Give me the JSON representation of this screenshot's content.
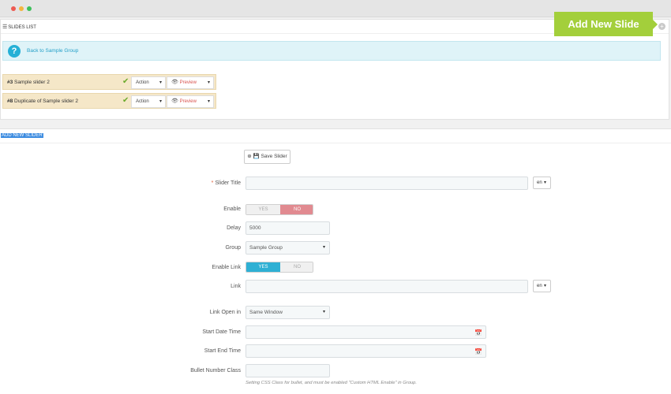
{
  "slides_list": {
    "title": "SLIDES LIST",
    "add_badge": "Add New Slide",
    "back_link": "Back to Sample Group",
    "rows": [
      {
        "id": "#3",
        "name": "Sample slider 2",
        "action_label": "Action",
        "preview_label": "Preview"
      },
      {
        "id": "#8",
        "name": "Duplicate of Sample slider 2",
        "action_label": "Action",
        "preview_label": "Preview"
      }
    ]
  },
  "form": {
    "title": "ADD NEW SLIDER",
    "save_label": "Save Slider",
    "slider_title": {
      "label": "Slider Title",
      "required": "*",
      "value": "",
      "lang": "en"
    },
    "enable": {
      "label": "Enable",
      "yes": "YES",
      "no": "NO",
      "selected": "NO"
    },
    "delay": {
      "label": "Delay",
      "value": "5000"
    },
    "group": {
      "label": "Group",
      "value": "Sample Group"
    },
    "enable_link": {
      "label": "Enable Link",
      "yes": "YES",
      "no": "NO",
      "selected": "YES"
    },
    "link": {
      "label": "Link",
      "value": "",
      "lang": "en"
    },
    "link_open_in": {
      "label": "Link Open in",
      "value": "Same Window"
    },
    "start_date": {
      "label": "Start Date Time",
      "value": ""
    },
    "end_date": {
      "label": "Start End Time",
      "value": ""
    },
    "bullet_class": {
      "label": "Bullet Number Class",
      "value": "",
      "help": "Setting CSS Class for bullet, and must be enabled \"Custom HTML Enable\" in Group."
    }
  },
  "colors": {
    "accent_green": "#a3cf3b",
    "info_blue": "#25b0d6",
    "toggle_yes": "#2fb0d4",
    "toggle_no": "#e18a90"
  }
}
